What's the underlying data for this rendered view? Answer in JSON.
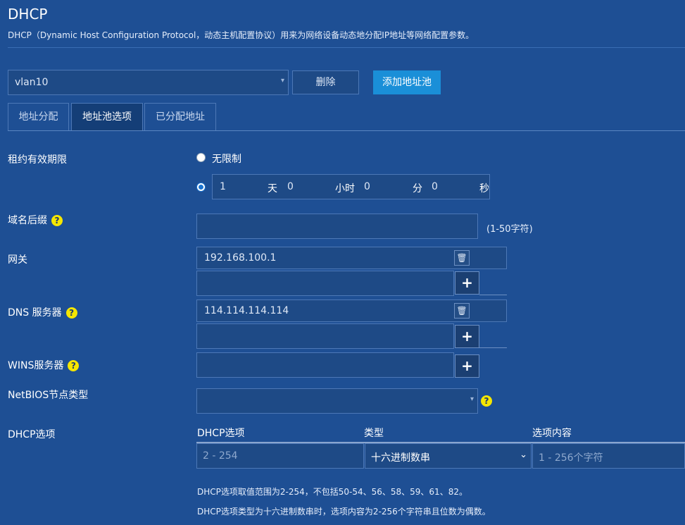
{
  "header": {
    "title": "DHCP",
    "description": "DHCP（Dynamic Host Configuration Protocol，动态主机配置协议）用来为网络设备动态地分配IP地址等网络配置参数。"
  },
  "toolbar": {
    "pool_value": "vlan10",
    "delete_label": "删除",
    "add_pool_label": "添加地址池"
  },
  "tabs": [
    {
      "label": "地址分配",
      "active": false
    },
    {
      "label": "地址池选项",
      "active": true
    },
    {
      "label": "已分配地址",
      "active": false
    }
  ],
  "lease": {
    "label": "租约有效期限",
    "unlimited_label": "无限制",
    "days_value": "1",
    "days_unit": "天",
    "hours_value": "0",
    "hours_unit": "小时",
    "minutes_value": "0",
    "minutes_unit": "分",
    "seconds_value": "0",
    "seconds_unit": "秒",
    "selected": "custom"
  },
  "domain_suffix": {
    "label": "域名后缀",
    "value": "",
    "hint": "(1-50字符)"
  },
  "gateway": {
    "label": "网关",
    "value": "192.168.100.1"
  },
  "dns": {
    "label": "DNS 服务器",
    "value": "114.114.114.114"
  },
  "wins": {
    "label": "WINS服务器",
    "value": ""
  },
  "netbios": {
    "label": "NetBIOS节点类型",
    "value": ""
  },
  "dhcp_options": {
    "label": "DHCP选项",
    "col_option": "DHCP选项",
    "col_type": "类型",
    "col_content": "选项内容",
    "option_placeholder": "2 - 254",
    "type_value": "十六进制数串",
    "content_placeholder": "1 - 256个字符",
    "note1": "DHCP选项取值范围为2-254，不包括50-54、56、58、59、61、82。",
    "note2": "DHCP选项类型为十六进制数串时，选项内容为2-256个字符串且位数为偶数。"
  },
  "icons": {
    "help": "?",
    "trash": "🗑",
    "plus": "+",
    "caret": "▾",
    "chevron": "⌄"
  },
  "colors": {
    "background": "#1e4f94",
    "accent_button": "#1a8fd8",
    "help_badge": "#f5e600"
  }
}
